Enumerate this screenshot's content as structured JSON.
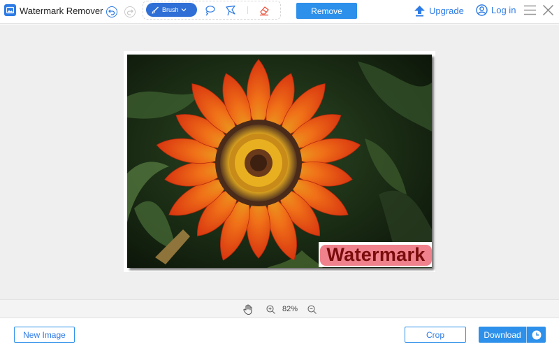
{
  "app": {
    "title": "Watermark Remover",
    "icon": "image-icon",
    "accent_color": "#2d7be5"
  },
  "toolbar": {
    "undo_icon": "undo-icon",
    "redo_icon": "redo-icon",
    "brush_label": "Brush",
    "brush_icon": "brush-icon",
    "lasso_icon": "lasso-icon",
    "polygon_icon": "polygon-lasso-icon",
    "eraser_icon": "eraser-icon",
    "remove_label": "Remove",
    "upgrade_label": "Upgrade",
    "login_label": "Log in",
    "menu_icon": "hamburger-menu-icon",
    "close_icon": "close-icon"
  },
  "canvas": {
    "image_description_icon": "flower-photo",
    "watermark_text": "Watermark",
    "mask_color": "#ec6c78"
  },
  "zoombar": {
    "hand_icon": "hand-pan-icon",
    "zoom_in_icon": "zoom-in-icon",
    "zoom_level": "82%",
    "zoom_out_icon": "zoom-out-icon"
  },
  "footer": {
    "new_image_label": "New Image",
    "crop_label": "Crop",
    "download_label": "Download",
    "history_icon": "clock-history-icon"
  }
}
